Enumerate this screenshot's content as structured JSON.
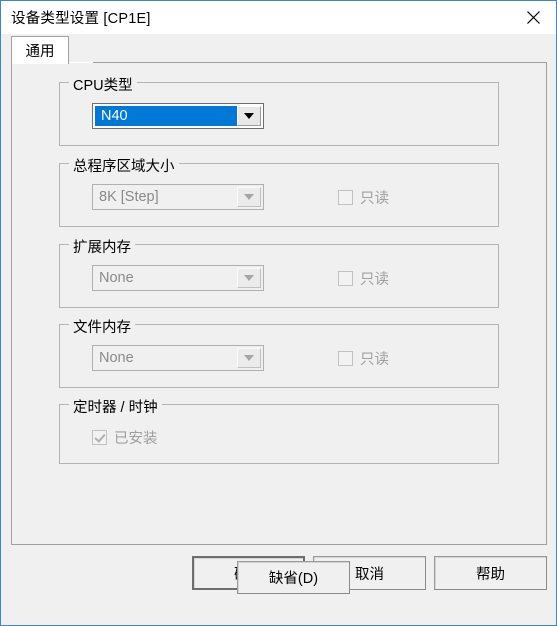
{
  "window": {
    "title": "设备类型设置 [CP1E]",
    "close_icon": "close-icon",
    "accent_color": "#0078d7",
    "border_color": "#3a86c8"
  },
  "tabs": [
    {
      "label": "通用",
      "selected": true
    }
  ],
  "groups": [
    {
      "id": "cpu-type",
      "label": "CPU类型",
      "combo": {
        "value": "N40",
        "enabled": true,
        "selected": true
      },
      "checkbox": null
    },
    {
      "id": "program-area-size",
      "label": "总程序区域大小",
      "combo": {
        "value": "8K [Step]",
        "enabled": false,
        "selected": false
      },
      "checkbox": {
        "label": "只读",
        "checked": false,
        "enabled": false
      }
    },
    {
      "id": "expansion-memory",
      "label": "扩展内存",
      "combo": {
        "value": "None",
        "enabled": false,
        "selected": false
      },
      "checkbox": {
        "label": "只读",
        "checked": false,
        "enabled": false
      }
    },
    {
      "id": "file-memory",
      "label": "文件内存",
      "combo": {
        "value": "None",
        "enabled": false,
        "selected": false
      },
      "checkbox": {
        "label": "只读",
        "checked": false,
        "enabled": false
      }
    },
    {
      "id": "timer-clock",
      "label": "定时器 / 时钟",
      "combo": null,
      "checkbox": {
        "label": "已安装",
        "checked": true,
        "enabled": false
      }
    }
  ],
  "default_button": {
    "label": "缺省(D)"
  },
  "footer": {
    "ok": "确定",
    "cancel": "取消",
    "help": "帮助"
  }
}
